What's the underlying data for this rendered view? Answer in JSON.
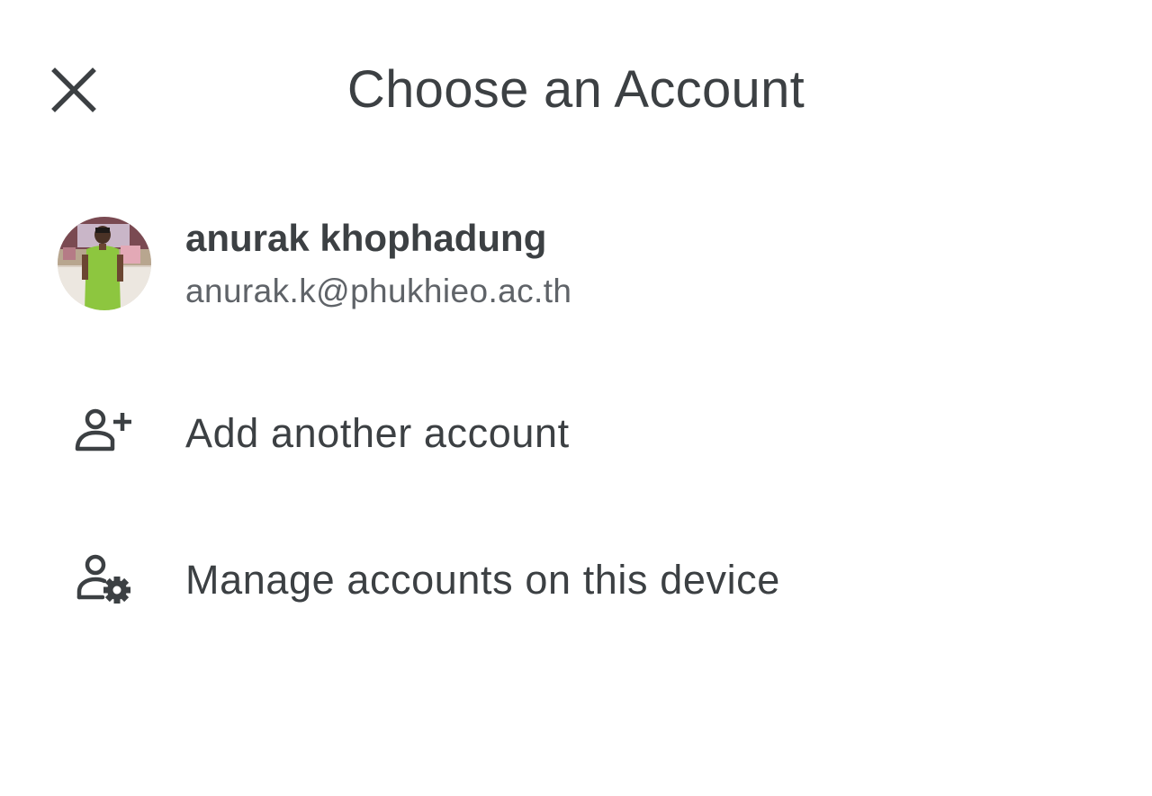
{
  "header": {
    "title": "Choose an Account",
    "close_icon": "close-icon"
  },
  "account": {
    "name": "anurak khophadung",
    "email": "anurak.k@phukhieo.ac.th",
    "avatar": "user-photo-avatar"
  },
  "menu": {
    "add_account": {
      "label": "Add another account",
      "icon": "person-add-icon"
    },
    "manage_accounts": {
      "label": "Manage accounts on this device",
      "icon": "manage-accounts-icon"
    }
  },
  "colors": {
    "text_primary": "#3c4043",
    "text_secondary": "#5f6368",
    "background": "#ffffff",
    "avatar_shirt": "#8dc63f"
  }
}
